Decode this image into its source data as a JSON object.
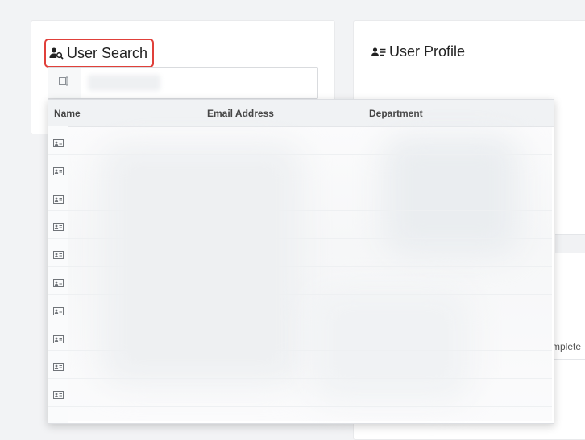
{
  "search_card": {
    "title": "User Search",
    "title_icon": "user-search-icon",
    "input_icon": "id-card-icon",
    "input_value": ""
  },
  "profile_card": {
    "title": "User Profile",
    "title_icon": "user-list-icon",
    "partial_text": "mplete"
  },
  "results": {
    "columns": [
      "Name",
      "Email Address",
      "Department"
    ],
    "row_icon": "contact-card-icon",
    "row_count": 10
  },
  "colors": {
    "highlight_border": "#e0403a",
    "page_background": "#f2f3f5",
    "card_background": "#ffffff"
  }
}
